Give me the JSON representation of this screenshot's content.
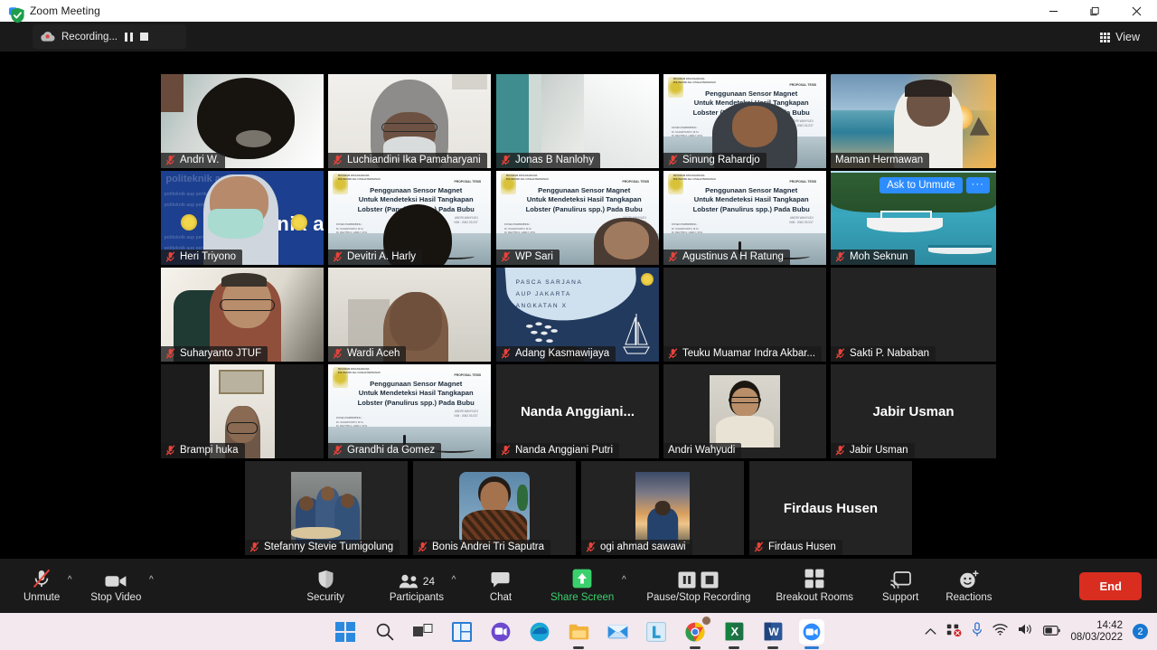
{
  "window": {
    "title": "Zoom Meeting",
    "app_icon": "zoom-camera-icon",
    "minimize": "minimize-icon",
    "maximize": "maximize-icon",
    "close": "close-icon"
  },
  "topbar": {
    "security_icon": "shield-check-icon",
    "recording_label": "Recording...",
    "recording_icon": "recording-cloud-icon",
    "pause_icon": "pause-icon",
    "stop_icon": "stop-icon",
    "view_label": "View",
    "view_icon": "grid-view-icon"
  },
  "gallery": {
    "overlay": {
      "ask_to_unmute": "Ask to Unmute",
      "more_options": "···"
    },
    "participants": [
      {
        "name": "Andri  W.",
        "muted": true,
        "style": "ceiling",
        "speaking": false
      },
      {
        "name": "Luchiandini Ika Pamaharyani",
        "muted": true,
        "style": "hijab",
        "speaking": false
      },
      {
        "name": "Jonas B Nanlohy",
        "muted": true,
        "style": "ceiling2",
        "speaking": false
      },
      {
        "name": "Sinung Rahardjo",
        "muted": true,
        "style": "slide",
        "speaking": false
      },
      {
        "name": "Maman Hermawan",
        "muted": false,
        "style": "beach",
        "speaking": true
      },
      {
        "name": "Heri Triyono",
        "muted": true,
        "style": "aup-banner",
        "speaking": false
      },
      {
        "name": "Devitri A. Harly",
        "muted": true,
        "style": "slide",
        "speaking": false
      },
      {
        "name": "WP Sari",
        "muted": true,
        "style": "slide",
        "speaking": false
      },
      {
        "name": "Agustinus A H Ratung",
        "muted": true,
        "style": "slide",
        "speaking": false
      },
      {
        "name": "Moh Seknun",
        "muted": true,
        "style": "island",
        "speaking": false,
        "ask_to_unmute": true
      },
      {
        "name": "Suharyanto JTUF",
        "muted": true,
        "style": "office",
        "speaking": false
      },
      {
        "name": "Wardi Aceh",
        "muted": true,
        "style": "wall",
        "speaking": false
      },
      {
        "name": "Adang Kasmawijaya",
        "muted": true,
        "style": "pasca",
        "speaking": false
      },
      {
        "name": "Teuku Muamar Indra Akbar...",
        "muted": true,
        "style": "dark",
        "speaking": false
      },
      {
        "name": "Sakti P. Nababan",
        "muted": true,
        "style": "dark",
        "speaking": false
      },
      {
        "name": "Brampi huka",
        "muted": true,
        "style": "portrait-room",
        "speaking": false
      },
      {
        "name": "Grandhi da Gomez",
        "muted": true,
        "style": "slide",
        "speaking": false
      },
      {
        "name": "Nanda Anggiani Putri",
        "muted": true,
        "style": "name-only",
        "display_name": "Nanda  Anggiani...",
        "speaking": false
      },
      {
        "name": "Andri Wahyudi",
        "muted": false,
        "style": "avatar-photo",
        "speaking": false
      },
      {
        "name": "Jabir Usman",
        "muted": true,
        "style": "name-only",
        "display_name": "Jabir Usman",
        "speaking": false
      },
      {
        "name": "Stefanny Stevie Tumigolung",
        "muted": true,
        "style": "avatar-group",
        "speaking": false
      },
      {
        "name": "Bonis Andrei Tri Saputra",
        "muted": true,
        "style": "avatar-batik",
        "speaking": false
      },
      {
        "name": "ogi ahmad sawawi",
        "muted": true,
        "style": "avatar-sunset",
        "speaking": false
      },
      {
        "name": "Firdaus Husen",
        "muted": true,
        "style": "name-only",
        "display_name": "Firdaus Husen",
        "speaking": false
      }
    ]
  },
  "slide_content": {
    "org_line1": "PROGRAM PASCASARJANA",
    "org_line2": "POLITEKNIK AHLI USAHA PERIKANAN",
    "kicker": "PROPOSAL TESIS",
    "title_line1": "Penggunaan Sensor Magnet",
    "title_line2": "Untuk Mendeteksi Hasil Tangkapan",
    "title_line3": "Lobster (Panulirus spp.) Pada Bubu",
    "author": "ANDRI WAHYUDI",
    "nim": "NIM : 2062.03.037",
    "advisor_head": "DOSEN PEMBIMBING :",
    "advisor1": "Dr. SUHARYANTO, M.Si.",
    "advisor2": "Dr. DEVITRI A. HARLY, M.Si."
  },
  "aup_banner": {
    "word": "politeknik aup",
    "small_word": "politeknik aup perikanan"
  },
  "pasca_slide": {
    "line1": "PASCA SARJANA",
    "line2": "AUP JAKARTA",
    "line3": "ANGKATAN X"
  },
  "toolbar": {
    "items": [
      {
        "label": "Unmute",
        "icon": "microphone-muted-icon",
        "caret": true,
        "accent": false
      },
      {
        "label": "Stop Video",
        "icon": "video-camera-icon",
        "caret": true,
        "accent": false
      },
      {
        "label": "Security",
        "icon": "shield-icon",
        "caret": false,
        "accent": false
      },
      {
        "label": "Participants",
        "icon": "participants-icon",
        "caret": true,
        "accent": false,
        "count": "24"
      },
      {
        "label": "Chat",
        "icon": "chat-bubble-icon",
        "caret": false,
        "accent": false
      },
      {
        "label": "Share Screen",
        "icon": "share-screen-icon",
        "caret": true,
        "accent": true
      },
      {
        "label": "Pause/Stop Recording",
        "icon": "pause-stop-recording-icon",
        "caret": false,
        "accent": false
      },
      {
        "label": "Breakout Rooms",
        "icon": "breakout-rooms-icon",
        "caret": false,
        "accent": false
      },
      {
        "label": "Support",
        "icon": "support-cast-icon",
        "caret": false,
        "accent": false
      },
      {
        "label": "Reactions",
        "icon": "reactions-smiley-icon",
        "caret": false,
        "accent": false
      }
    ],
    "end_label": "End"
  },
  "taskbar": {
    "apps": [
      {
        "name": "start-windows-icon",
        "running": false
      },
      {
        "name": "search-icon",
        "running": false
      },
      {
        "name": "task-view-icon",
        "running": false
      },
      {
        "name": "widgets-icon",
        "running": false
      },
      {
        "name": "teams-chat-icon",
        "running": false
      },
      {
        "name": "microsoft-edge-icon",
        "running": false
      },
      {
        "name": "file-explorer-icon",
        "running": true
      },
      {
        "name": "mail-icon",
        "running": false
      },
      {
        "name": "lightshot-icon",
        "running": false
      },
      {
        "name": "google-chrome-icon",
        "running": true
      },
      {
        "name": "microsoft-excel-icon",
        "running": true
      },
      {
        "name": "microsoft-word-icon",
        "running": true
      },
      {
        "name": "zoom-icon",
        "running": true,
        "active": true
      }
    ],
    "tray": {
      "overflow_icon": "chevron-up-icon",
      "network_alert_icon": "network-error-icon",
      "microphone_icon": "microphone-icon",
      "wifi_icon": "wifi-icon",
      "volume_icon": "speaker-icon",
      "battery_icon": "battery-icon",
      "time": "14:42",
      "date": "08/03/2022",
      "notification_count": "2"
    }
  }
}
